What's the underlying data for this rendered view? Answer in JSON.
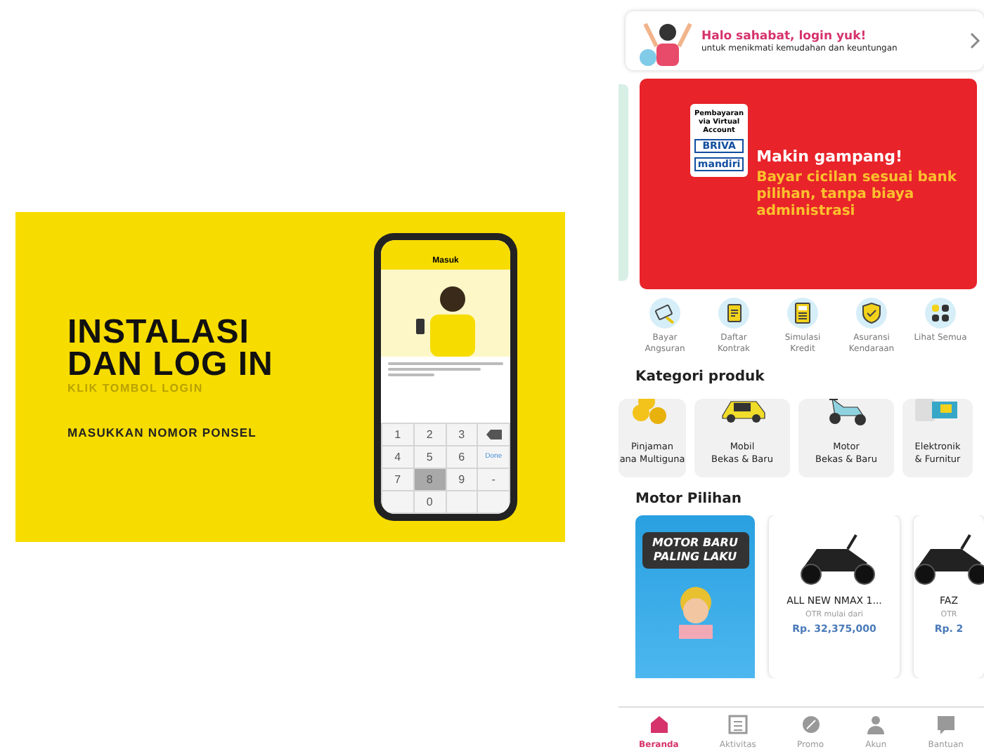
{
  "tutorial_image": {
    "title_lines": [
      "INSTALASI",
      "DAN LOG IN"
    ],
    "subtitle": "KLIK TOMBOL LOGIN",
    "step": "MASUKKAN NOMOR PONSEL",
    "phone": {
      "header": "Masuk",
      "keys": [
        {
          "kind": "digit",
          "label": "1",
          "pressed": false
        },
        {
          "kind": "digit",
          "label": "2",
          "pressed": false
        },
        {
          "kind": "digit",
          "label": "3",
          "pressed": false
        },
        {
          "kind": "backspace",
          "pressed": false
        },
        {
          "kind": "digit",
          "label": "4",
          "pressed": false
        },
        {
          "kind": "digit",
          "label": "5",
          "pressed": false
        },
        {
          "kind": "digit",
          "label": "6",
          "pressed": false
        },
        {
          "kind": "action",
          "label": "Done",
          "pressed": false
        },
        {
          "kind": "digit",
          "label": "7",
          "pressed": false
        },
        {
          "kind": "digit",
          "label": "8",
          "pressed": true
        },
        {
          "kind": "digit",
          "label": "9",
          "pressed": false
        },
        {
          "kind": "digit",
          "label": "-",
          "pressed": false
        },
        {
          "kind": "blank"
        },
        {
          "kind": "digit",
          "label": "0",
          "pressed": false
        },
        {
          "kind": "blank"
        },
        {
          "kind": "blank"
        }
      ]
    }
  },
  "login_card": {
    "title": "Halo sahabat, login yuk!",
    "subtitle": "untuk menikmati kemudahan dan keuntungan"
  },
  "promo_banner": {
    "board_title": "Pembayaran via Virtual Account",
    "bank_logos": [
      "BRIVA",
      "mandiri"
    ],
    "headline": "Makin gampang!",
    "body": "Bayar cicilan sesuai bank pilihan, tanpa biaya administrasi"
  },
  "quick_menu": [
    {
      "kind": "pay",
      "label": "Bayar Angsuran"
    },
    {
      "kind": "contract",
      "label": "Daftar Kontrak"
    },
    {
      "kind": "calculator",
      "label": "Simulasi Kredit"
    },
    {
      "kind": "shield",
      "label": "Asuransi Kendaraan"
    },
    {
      "kind": "grid",
      "label": "Lihat Semua"
    }
  ],
  "categories": {
    "title": "Kategori produk",
    "items": [
      {
        "kind": "coins",
        "lines": [
          "Pinjaman",
          "ana Multiguna"
        ]
      },
      {
        "kind": "car",
        "lines": [
          "Mobil",
          "Bekas & Baru"
        ]
      },
      {
        "kind": "scooter",
        "lines": [
          "Motor",
          "Bekas & Baru"
        ]
      },
      {
        "kind": "appliance",
        "lines": [
          "Elektronik",
          "& Furnitur"
        ]
      }
    ]
  },
  "motor_section": {
    "title": "Motor Pilihan",
    "banner_text": "MOTOR BARU PALING LAKU",
    "products": [
      {
        "name": "ALL NEW NMAX 1...",
        "note": "OTR mulai dari",
        "price": "Rp. 32,375,000"
      },
      {
        "name": "FAZ",
        "note": "OTR",
        "price": "Rp. 2"
      }
    ]
  },
  "bottom_nav": [
    {
      "kind": "home",
      "label": "Beranda",
      "selected": true
    },
    {
      "kind": "list",
      "label": "Aktivitas",
      "selected": false
    },
    {
      "kind": "promo",
      "label": "Promo",
      "selected": false
    },
    {
      "kind": "user",
      "label": "Akun",
      "selected": false
    },
    {
      "kind": "help",
      "label": "Bantuan",
      "selected": false
    }
  ]
}
